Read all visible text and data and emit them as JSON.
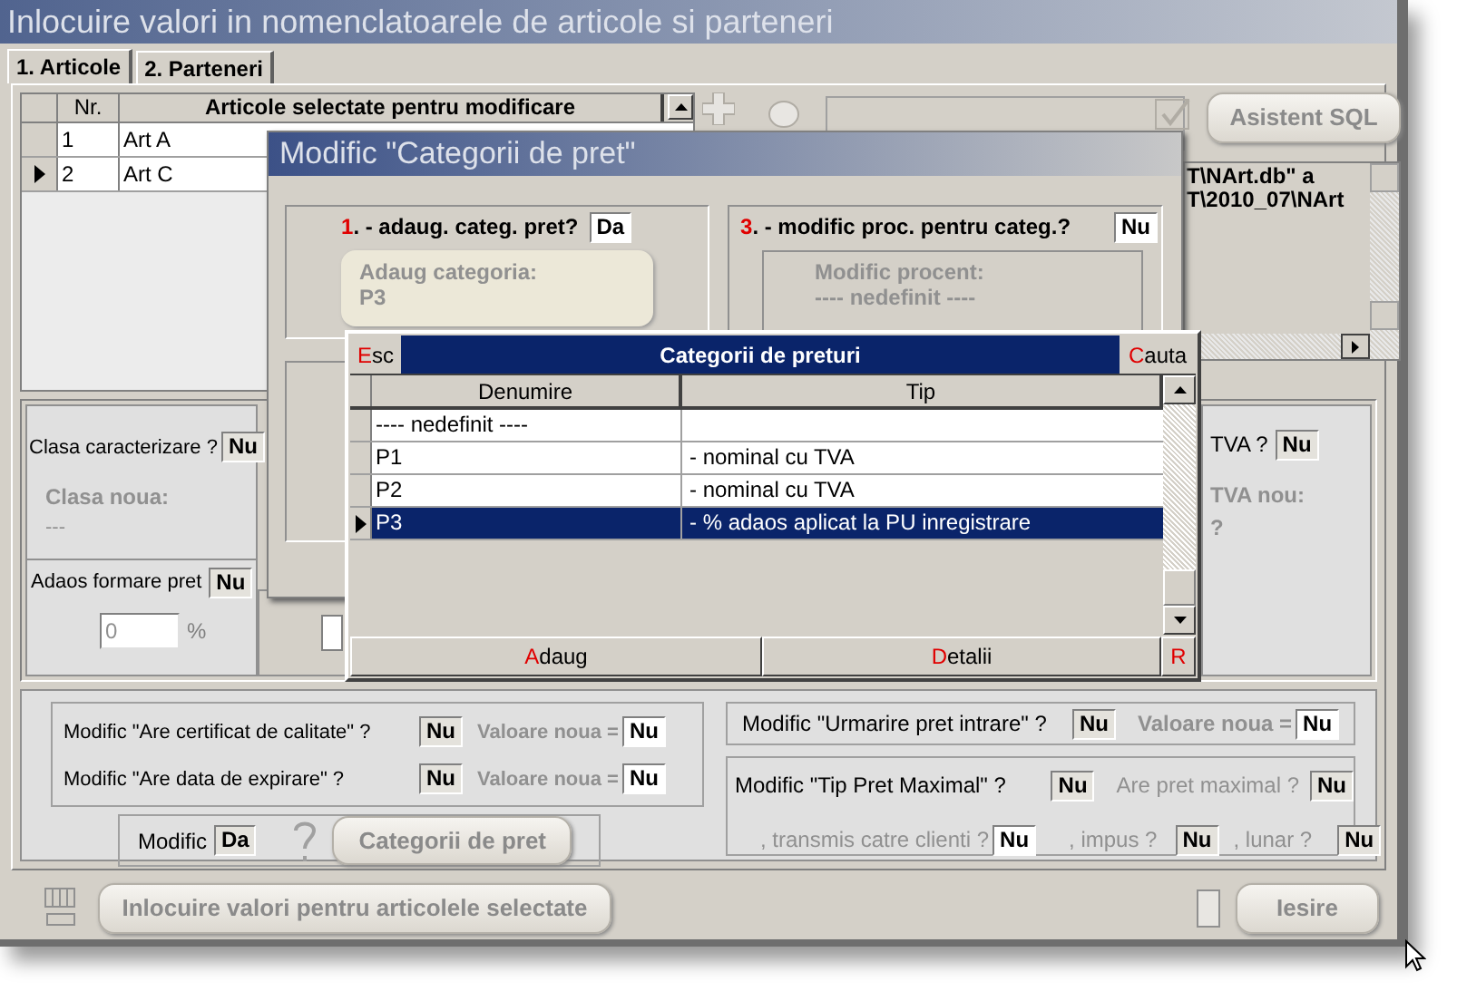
{
  "window": {
    "title": "Inlocuire valori in nomenclatoarele de articole si parteneri"
  },
  "tabs": [
    {
      "label": "1. Articole",
      "selected": true
    },
    {
      "label": "2. Parteneri",
      "selected": false
    }
  ],
  "articles_grid": {
    "columns": [
      "Nr.",
      "Articole selectate pentru modificare"
    ],
    "rows": [
      {
        "cells": [
          "1",
          "Art A"
        ],
        "selected": false
      },
      {
        "cells": [
          "2",
          "Art C"
        ],
        "selected": true
      }
    ]
  },
  "sql_button": "Asistent SQL",
  "sql_log": [
    "T\\NArt.db\" a",
    "T\\2010_07\\NArt"
  ],
  "clasa": {
    "label": "Clasa caracterizare ?",
    "value": "Nu",
    "new_label": "Clasa noua:",
    "new_value": "---"
  },
  "adaos": {
    "label": "Adaos formare pret",
    "value": "Nu",
    "input": "0",
    "unit": "%"
  },
  "tva": {
    "label": "TVA ?",
    "value": "Nu",
    "new_label": "TVA nou:",
    "new_value": "?"
  },
  "flags": [
    {
      "label": "Modific \"Are certificat de calitate\" ?",
      "value": "Nu",
      "new_label": "Valoare noua =",
      "new_value": "Nu"
    },
    {
      "label": "Modific \"Are data de expirare\" ?",
      "value": "Nu",
      "new_label": "Valoare noua =",
      "new_value": "Nu"
    }
  ],
  "urmarire": {
    "label": "Modific \"Urmarire pret intrare\" ?",
    "value": "Nu",
    "new_label": "Valoare noua =",
    "new_value": "Nu"
  },
  "tip_pret": {
    "label": "Modific \"Tip Pret Maximal\" ?",
    "value": "Nu",
    "options": [
      {
        "label": "Are pret maximal ?",
        "value": "Nu"
      },
      {
        "label": ", transmis catre clienti ?",
        "value": "Nu"
      },
      {
        "label": ", impus ?",
        "value": "Nu"
      },
      {
        "label": ", lunar ?",
        "value": "Nu"
      }
    ]
  },
  "categorii": {
    "label": "Modific",
    "value": "Da",
    "button": "Categorii de pret"
  },
  "footer": {
    "apply_button": "Inlocuire valori pentru articolele selectate",
    "exit_button": "Iesire"
  },
  "dialog": {
    "title": "Modific \"Categorii de pret\"",
    "section_1": {
      "label": "1. - adaug. categ. pret?",
      "value": "Da",
      "field_label": "Adaug categoria:",
      "field_value": "P3"
    },
    "section_3": {
      "label": "3. - modific proc. pentru categ.?",
      "value": "Nu",
      "field_label": "Modific procent:",
      "field_value": "---- nedefinit ----"
    }
  },
  "lookup": {
    "esc": "Esc",
    "title": "Categorii de preturi",
    "search": "Cauta",
    "columns": [
      "Denumire",
      "Tip"
    ],
    "rows": [
      {
        "name": "---- nedefinit ----",
        "selected": false
      },
      {
        "name": "P1",
        "type": "- nominal cu TVA",
        "selected": false
      },
      {
        "name": "P2",
        "type": "- nominal cu TVA",
        "selected": false
      },
      {
        "name": "P3",
        "type": "- % adaos aplicat la PU inregistrare",
        "selected": true
      }
    ],
    "buttons": [
      "Adaug",
      "Detalii",
      "R"
    ]
  }
}
